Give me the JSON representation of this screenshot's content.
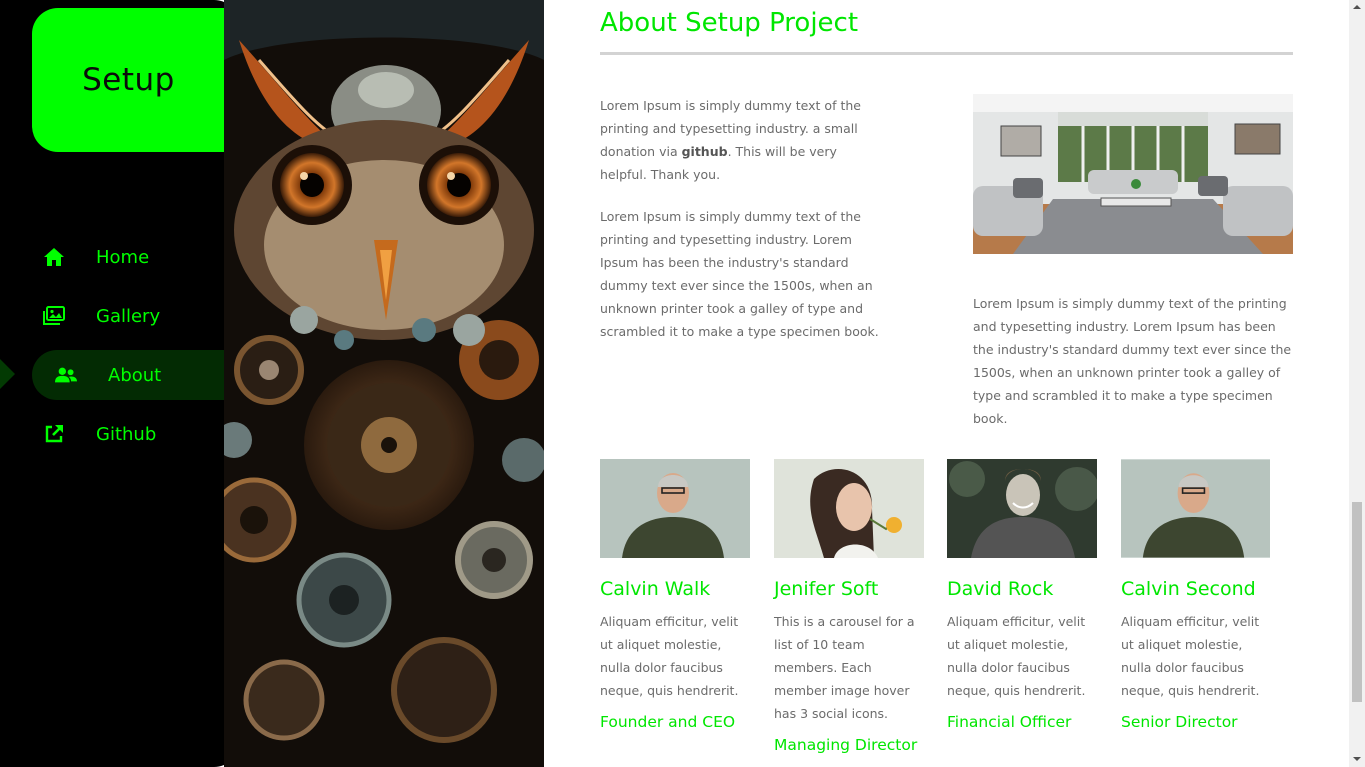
{
  "brand": {
    "logo_text": "Setup",
    "accent": "#00ff00"
  },
  "nav": {
    "items": [
      {
        "label": "Home",
        "icon": "home-icon",
        "active": false
      },
      {
        "label": "Gallery",
        "icon": "images-icon",
        "active": false
      },
      {
        "label": "About",
        "icon": "users-icon",
        "active": true
      },
      {
        "label": "Github",
        "icon": "external-link-icon",
        "active": false
      }
    ]
  },
  "about": {
    "title": "About Setup Project",
    "intro_before": "Lorem Ipsum is simply dummy text of the printing and typesetting industry. a small donation via ",
    "intro_link": "github",
    "intro_after": ". This will be very helpful. Thank you.",
    "para2": "Lorem Ipsum is simply dummy text of the printing and typesetting industry. Lorem Ipsum has been the industry's standard dummy text ever since the 1500s, when an unknown printer took a galley of type and scrambled it to make a type specimen book.",
    "para3": "Lorem Ipsum is simply dummy text of the printing and typesetting industry. Lorem Ipsum has been the industry's standard dummy text ever since the 1500s, when an unknown printer took a galley of type and scrambled it to make a type specimen book."
  },
  "team": [
    {
      "name": "Calvin Walk",
      "desc": "Aliquam efficitur, velit ut aliquet molestie, nulla dolor faucibus neque, quis hendrerit.",
      "role": "Founder and CEO"
    },
    {
      "name": "Jenifer Soft",
      "desc": "This is a carousel for a list of 10 team members. Each member image hover has 3 social icons.",
      "role": "Managing Director"
    },
    {
      "name": "David Rock",
      "desc": "Aliquam efficitur, velit ut aliquet molestie, nulla dolor faucibus neque, quis hendrerit.",
      "role": "Financial Officer"
    },
    {
      "name": "Calvin Second",
      "desc": "Aliquam efficitur, velit ut aliquet molestie, nulla dolor faucibus neque, quis hendrerit.",
      "role": "Senior Director"
    }
  ]
}
